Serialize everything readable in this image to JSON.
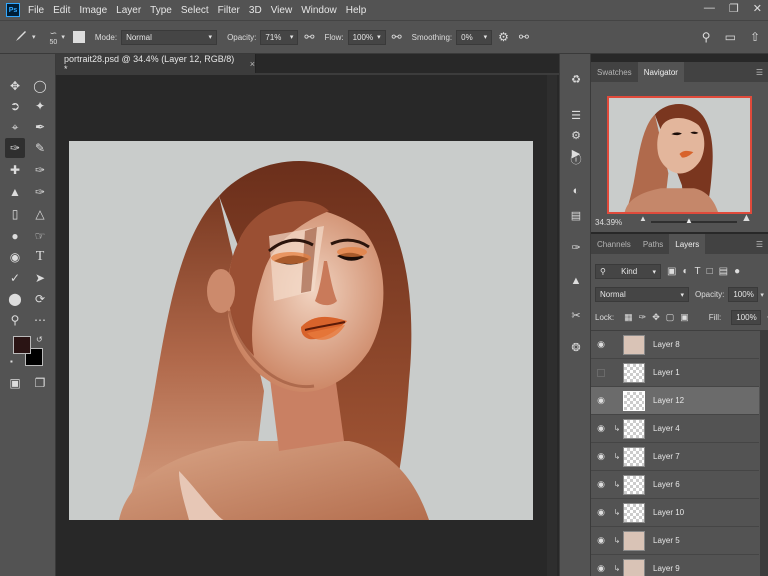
{
  "menubar": {
    "logo": "Ps",
    "items": [
      "File",
      "Edit",
      "Image",
      "Layer",
      "Type",
      "Select",
      "Filter",
      "3D",
      "View",
      "Window",
      "Help"
    ],
    "window_controls": [
      "—",
      "❐",
      "✕"
    ]
  },
  "options": {
    "brush_size": "50",
    "mode_label": "Mode:",
    "mode_value": "Normal",
    "opacity_label": "Opacity:",
    "opacity_value": "71%",
    "flow_label": "Flow:",
    "flow_value": "100%",
    "smoothing_label": "Smoothing:",
    "smoothing_value": "0%"
  },
  "document": {
    "tab_title": "portrait28.psd @ 34.4% (Layer 12, RGB/8) *",
    "close": "×"
  },
  "navigator": {
    "tabs": [
      "Swatches",
      "Navigator"
    ],
    "active_tab": "Navigator",
    "zoom": "34.39%"
  },
  "layers_panel": {
    "tabs": [
      "Channels",
      "Paths",
      "Layers"
    ],
    "active_tab": "Layers",
    "kind_label": "Kind",
    "blend_mode": "Normal",
    "opacity_label": "Opacity:",
    "opacity_value": "100%",
    "lock_label": "Lock:",
    "fill_label": "Fill:",
    "fill_value": "100%",
    "layers": [
      {
        "name": "Layer 8",
        "visible": true,
        "clipped": false,
        "selected": false,
        "thumb": "paint"
      },
      {
        "name": "Layer 1",
        "visible": false,
        "clipped": false,
        "selected": false,
        "thumb": "empty"
      },
      {
        "name": "Layer 12",
        "visible": true,
        "clipped": false,
        "selected": true,
        "thumb": "empty"
      },
      {
        "name": "Layer 4",
        "visible": true,
        "clipped": true,
        "selected": false,
        "thumb": "empty"
      },
      {
        "name": "Layer 7",
        "visible": true,
        "clipped": true,
        "selected": false,
        "thumb": "empty"
      },
      {
        "name": "Layer 6",
        "visible": true,
        "clipped": true,
        "selected": false,
        "thumb": "empty"
      },
      {
        "name": "Layer 10",
        "visible": true,
        "clipped": true,
        "selected": false,
        "thumb": "empty"
      },
      {
        "name": "Layer 5",
        "visible": true,
        "clipped": true,
        "selected": false,
        "thumb": "paint"
      },
      {
        "name": "Layer 9",
        "visible": true,
        "clipped": true,
        "selected": false,
        "thumb": "paint"
      }
    ]
  },
  "colors": {
    "foreground": "#2a1414",
    "background": "#000000",
    "navigator_frame": "#e04a3b"
  }
}
